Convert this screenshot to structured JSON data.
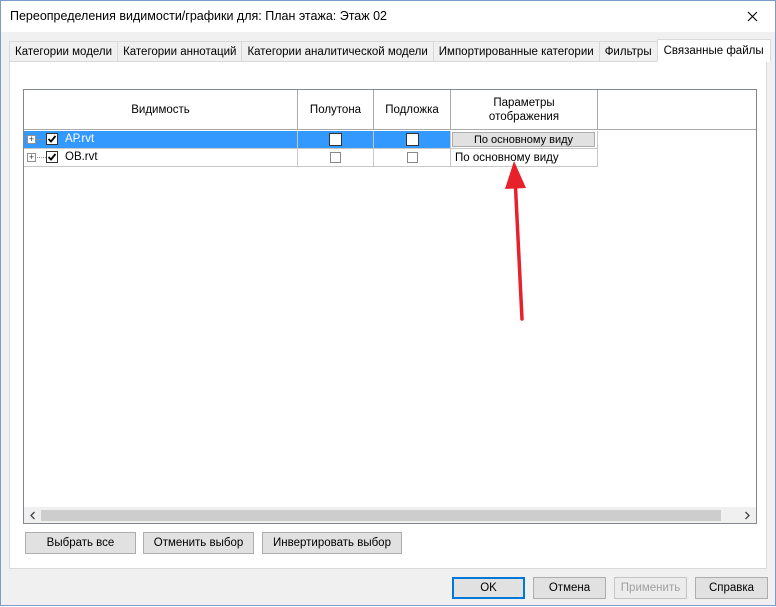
{
  "window": {
    "title": "Переопределения видимости/графики для: План этажа: Этаж 02",
    "close_glyph": "✕"
  },
  "tabs": [
    {
      "label": "Категории модели",
      "active": false
    },
    {
      "label": "Категории аннотаций",
      "active": false
    },
    {
      "label": "Категории аналитической модели",
      "active": false
    },
    {
      "label": "Импортированные категории",
      "active": false
    },
    {
      "label": "Фильтры",
      "active": false
    },
    {
      "label": "Связанные файлы",
      "active": true
    }
  ],
  "grid": {
    "columns": {
      "visibility": "Видимость",
      "halftone": "Полутона",
      "underlay": "Подложка",
      "display_settings": "Параметры отображения"
    },
    "rows": [
      {
        "name": "АР.rvt",
        "visible": true,
        "halftone": false,
        "underlay": false,
        "display": "По основному виду",
        "selected": true
      },
      {
        "name": "ОВ.rvt",
        "visible": true,
        "halftone": false,
        "underlay": false,
        "display": "По основному виду",
        "selected": false
      }
    ],
    "expander_glyph": "+"
  },
  "selection_buttons": {
    "select_all": "Выбрать все",
    "deselect": "Отменить выбор",
    "invert": "Инвертировать выбор"
  },
  "footer_buttons": {
    "ok": "OK",
    "cancel": "Отмена",
    "apply": "Применить",
    "help": "Справка"
  },
  "colors": {
    "selection": "#3399ff",
    "annotation_arrow": "#e8202a",
    "default_button_border": "#0078d7"
  },
  "icons": {
    "close": "close-icon",
    "expand": "plus-icon",
    "check": "checkmark-icon",
    "scroll_left": "chevron-left-icon",
    "scroll_right": "chevron-right-icon"
  }
}
